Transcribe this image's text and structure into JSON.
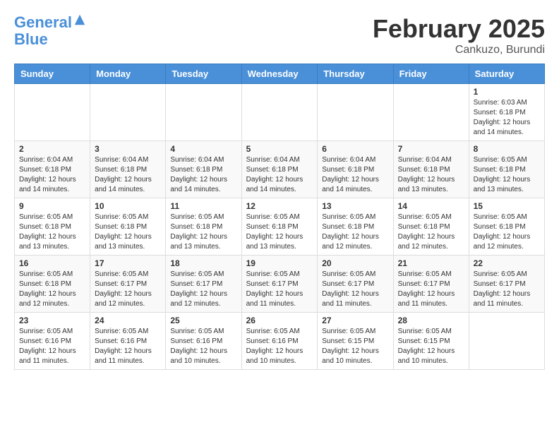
{
  "logo": {
    "line1": "General",
    "line2": "Blue"
  },
  "title": "February 2025",
  "location": "Cankuzo, Burundi",
  "weekdays": [
    "Sunday",
    "Monday",
    "Tuesday",
    "Wednesday",
    "Thursday",
    "Friday",
    "Saturday"
  ],
  "weeks": [
    [
      {
        "day": "",
        "info": ""
      },
      {
        "day": "",
        "info": ""
      },
      {
        "day": "",
        "info": ""
      },
      {
        "day": "",
        "info": ""
      },
      {
        "day": "",
        "info": ""
      },
      {
        "day": "",
        "info": ""
      },
      {
        "day": "1",
        "info": "Sunrise: 6:03 AM\nSunset: 6:18 PM\nDaylight: 12 hours\nand 14 minutes."
      }
    ],
    [
      {
        "day": "2",
        "info": "Sunrise: 6:04 AM\nSunset: 6:18 PM\nDaylight: 12 hours\nand 14 minutes."
      },
      {
        "day": "3",
        "info": "Sunrise: 6:04 AM\nSunset: 6:18 PM\nDaylight: 12 hours\nand 14 minutes."
      },
      {
        "day": "4",
        "info": "Sunrise: 6:04 AM\nSunset: 6:18 PM\nDaylight: 12 hours\nand 14 minutes."
      },
      {
        "day": "5",
        "info": "Sunrise: 6:04 AM\nSunset: 6:18 PM\nDaylight: 12 hours\nand 14 minutes."
      },
      {
        "day": "6",
        "info": "Sunrise: 6:04 AM\nSunset: 6:18 PM\nDaylight: 12 hours\nand 14 minutes."
      },
      {
        "day": "7",
        "info": "Sunrise: 6:04 AM\nSunset: 6:18 PM\nDaylight: 12 hours\nand 13 minutes."
      },
      {
        "day": "8",
        "info": "Sunrise: 6:05 AM\nSunset: 6:18 PM\nDaylight: 12 hours\nand 13 minutes."
      }
    ],
    [
      {
        "day": "9",
        "info": "Sunrise: 6:05 AM\nSunset: 6:18 PM\nDaylight: 12 hours\nand 13 minutes."
      },
      {
        "day": "10",
        "info": "Sunrise: 6:05 AM\nSunset: 6:18 PM\nDaylight: 12 hours\nand 13 minutes."
      },
      {
        "day": "11",
        "info": "Sunrise: 6:05 AM\nSunset: 6:18 PM\nDaylight: 12 hours\nand 13 minutes."
      },
      {
        "day": "12",
        "info": "Sunrise: 6:05 AM\nSunset: 6:18 PM\nDaylight: 12 hours\nand 13 minutes."
      },
      {
        "day": "13",
        "info": "Sunrise: 6:05 AM\nSunset: 6:18 PM\nDaylight: 12 hours\nand 12 minutes."
      },
      {
        "day": "14",
        "info": "Sunrise: 6:05 AM\nSunset: 6:18 PM\nDaylight: 12 hours\nand 12 minutes."
      },
      {
        "day": "15",
        "info": "Sunrise: 6:05 AM\nSunset: 6:18 PM\nDaylight: 12 hours\nand 12 minutes."
      }
    ],
    [
      {
        "day": "16",
        "info": "Sunrise: 6:05 AM\nSunset: 6:18 PM\nDaylight: 12 hours\nand 12 minutes."
      },
      {
        "day": "17",
        "info": "Sunrise: 6:05 AM\nSunset: 6:17 PM\nDaylight: 12 hours\nand 12 minutes."
      },
      {
        "day": "18",
        "info": "Sunrise: 6:05 AM\nSunset: 6:17 PM\nDaylight: 12 hours\nand 12 minutes."
      },
      {
        "day": "19",
        "info": "Sunrise: 6:05 AM\nSunset: 6:17 PM\nDaylight: 12 hours\nand 11 minutes."
      },
      {
        "day": "20",
        "info": "Sunrise: 6:05 AM\nSunset: 6:17 PM\nDaylight: 12 hours\nand 11 minutes."
      },
      {
        "day": "21",
        "info": "Sunrise: 6:05 AM\nSunset: 6:17 PM\nDaylight: 12 hours\nand 11 minutes."
      },
      {
        "day": "22",
        "info": "Sunrise: 6:05 AM\nSunset: 6:17 PM\nDaylight: 12 hours\nand 11 minutes."
      }
    ],
    [
      {
        "day": "23",
        "info": "Sunrise: 6:05 AM\nSunset: 6:16 PM\nDaylight: 12 hours\nand 11 minutes."
      },
      {
        "day": "24",
        "info": "Sunrise: 6:05 AM\nSunset: 6:16 PM\nDaylight: 12 hours\nand 11 minutes."
      },
      {
        "day": "25",
        "info": "Sunrise: 6:05 AM\nSunset: 6:16 PM\nDaylight: 12 hours\nand 10 minutes."
      },
      {
        "day": "26",
        "info": "Sunrise: 6:05 AM\nSunset: 6:16 PM\nDaylight: 12 hours\nand 10 minutes."
      },
      {
        "day": "27",
        "info": "Sunrise: 6:05 AM\nSunset: 6:15 PM\nDaylight: 12 hours\nand 10 minutes."
      },
      {
        "day": "28",
        "info": "Sunrise: 6:05 AM\nSunset: 6:15 PM\nDaylight: 12 hours\nand 10 minutes."
      },
      {
        "day": "",
        "info": ""
      }
    ]
  ]
}
